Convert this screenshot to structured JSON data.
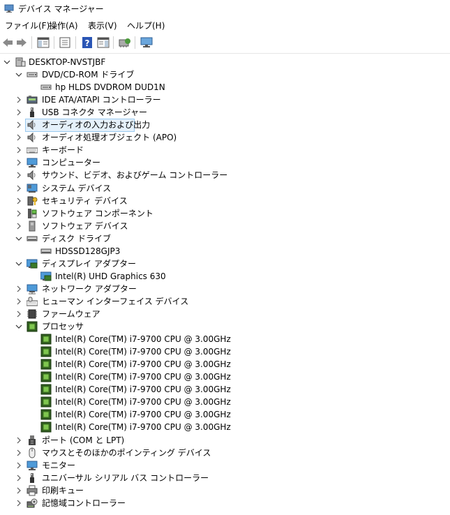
{
  "window": {
    "title": "デバイス マネージャー"
  },
  "menu": [
    {
      "label": "ファイル(F)"
    },
    {
      "label": "操作(A)"
    },
    {
      "label": "表示(V)"
    },
    {
      "label": "ヘルプ(H)"
    }
  ],
  "toolbar": {
    "buttons": [
      {
        "icon": "back-arrow-icon"
      },
      {
        "icon": "forward-arrow-icon"
      },
      {
        "icon": "console-tree-icon"
      },
      {
        "icon": "properties-icon"
      },
      {
        "icon": "help-icon"
      },
      {
        "icon": "action-pane-icon"
      },
      {
        "icon": "scan-hardware-icon"
      },
      {
        "icon": "monitor-icon"
      }
    ]
  },
  "tree": {
    "root": "DESKTOP-NVSTJBF",
    "items": [
      {
        "label": "DVD/CD-ROM ドライブ",
        "level": 1,
        "expanded": true,
        "icon": "dvd-drive-icon"
      },
      {
        "label": "hp HLDS DVDROM DUD1N",
        "level": 2,
        "icon": "dvd-drive-icon"
      },
      {
        "label": "IDE ATA/ATAPI コントローラー",
        "level": 1,
        "expanded": false,
        "icon": "ide-controller-icon"
      },
      {
        "label": "USB コネクタ マネージャー",
        "level": 1,
        "expanded": false,
        "icon": "usb-icon"
      },
      {
        "label": "オーディオの入力および出力",
        "level": 1,
        "expanded": false,
        "icon": "speaker-icon",
        "selected": true
      },
      {
        "label": "オーディオ処理オブジェクト (APO)",
        "level": 1,
        "expanded": false,
        "icon": "speaker-icon"
      },
      {
        "label": "キーボード",
        "level": 1,
        "expanded": false,
        "icon": "keyboard-icon"
      },
      {
        "label": "コンピューター",
        "level": 1,
        "expanded": false,
        "icon": "computer-icon"
      },
      {
        "label": "サウンド、ビデオ、およびゲーム コントローラー",
        "level": 1,
        "expanded": false,
        "icon": "speaker-icon"
      },
      {
        "label": "システム デバイス",
        "level": 1,
        "expanded": false,
        "icon": "system-device-icon"
      },
      {
        "label": "セキュリティ デバイス",
        "level": 1,
        "expanded": false,
        "icon": "security-key-icon"
      },
      {
        "label": "ソフトウェア コンポーネント",
        "level": 1,
        "expanded": false,
        "icon": "software-component-icon"
      },
      {
        "label": "ソフトウェア デバイス",
        "level": 1,
        "expanded": false,
        "icon": "software-device-icon"
      },
      {
        "label": "ディスク ドライブ",
        "level": 1,
        "expanded": true,
        "icon": "disk-drive-icon"
      },
      {
        "label": "HDSSD128GJP3",
        "level": 2,
        "icon": "disk-drive-icon"
      },
      {
        "label": "ディスプレイ アダプター",
        "level": 1,
        "expanded": true,
        "icon": "display-adapter-icon"
      },
      {
        "label": "Intel(R) UHD Graphics 630",
        "level": 2,
        "icon": "display-adapter-icon"
      },
      {
        "label": "ネットワーク アダプター",
        "level": 1,
        "expanded": false,
        "icon": "network-adapter-icon"
      },
      {
        "label": "ヒューマン インターフェイス デバイス",
        "level": 1,
        "expanded": false,
        "icon": "hid-icon"
      },
      {
        "label": "ファームウェア",
        "level": 1,
        "expanded": false,
        "icon": "firmware-icon"
      },
      {
        "label": "プロセッサ",
        "level": 1,
        "expanded": true,
        "icon": "processor-icon"
      },
      {
        "label": "Intel(R) Core(TM) i7-9700 CPU @ 3.00GHz",
        "level": 2,
        "icon": "processor-icon"
      },
      {
        "label": "Intel(R) Core(TM) i7-9700 CPU @ 3.00GHz",
        "level": 2,
        "icon": "processor-icon"
      },
      {
        "label": "Intel(R) Core(TM) i7-9700 CPU @ 3.00GHz",
        "level": 2,
        "icon": "processor-icon"
      },
      {
        "label": "Intel(R) Core(TM) i7-9700 CPU @ 3.00GHz",
        "level": 2,
        "icon": "processor-icon"
      },
      {
        "label": "Intel(R) Core(TM) i7-9700 CPU @ 3.00GHz",
        "level": 2,
        "icon": "processor-icon"
      },
      {
        "label": "Intel(R) Core(TM) i7-9700 CPU @ 3.00GHz",
        "level": 2,
        "icon": "processor-icon"
      },
      {
        "label": "Intel(R) Core(TM) i7-9700 CPU @ 3.00GHz",
        "level": 2,
        "icon": "processor-icon"
      },
      {
        "label": "Intel(R) Core(TM) i7-9700 CPU @ 3.00GHz",
        "level": 2,
        "icon": "processor-icon"
      },
      {
        "label": "ポート (COM と LPT)",
        "level": 1,
        "expanded": false,
        "icon": "port-icon"
      },
      {
        "label": "マウスとそのほかのポインティング デバイス",
        "level": 1,
        "expanded": false,
        "icon": "mouse-icon"
      },
      {
        "label": "モニター",
        "level": 1,
        "expanded": false,
        "icon": "monitor-icon"
      },
      {
        "label": "ユニバーサル シリアル バス コントローラー",
        "level": 1,
        "expanded": false,
        "icon": "usb-icon"
      },
      {
        "label": "印刷キュー",
        "level": 1,
        "expanded": false,
        "icon": "printer-icon"
      },
      {
        "label": "記憶域コントローラー",
        "level": 1,
        "expanded": false,
        "icon": "storage-controller-icon"
      }
    ]
  }
}
